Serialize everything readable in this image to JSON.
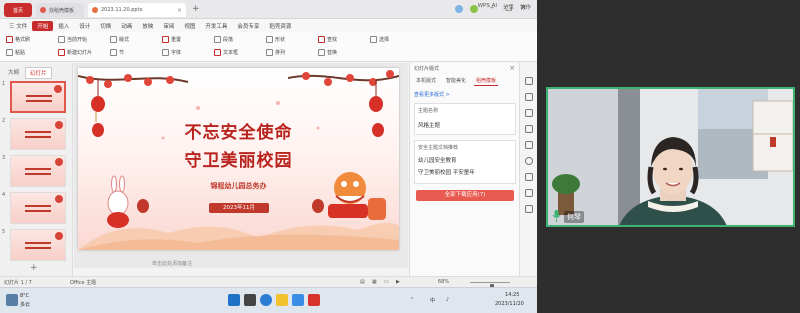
{
  "window": {
    "home_tab": "首页",
    "tabs": [
      {
        "label": "找稻壳模板"
      },
      {
        "label": "2023.11.20.pptx"
      }
    ],
    "new_tab_symbol": "+"
  },
  "menu": {
    "items": [
      "三 文件",
      "开始",
      "插入",
      "设计",
      "切换",
      "动画",
      "放映",
      "审阅",
      "视图",
      "开发工具",
      "会员专享",
      "稻壳资源"
    ],
    "active_index": 1,
    "right_items": [
      "WPS AI",
      "分享",
      "协作"
    ]
  },
  "ribbon": {
    "groups": [
      "格式刷",
      "粘贴",
      "当前开始",
      "新建幻灯片",
      "版式",
      "节",
      "重置",
      "字体",
      "段落",
      "文本框",
      "形状",
      "排列",
      "查找",
      "替换",
      "选择"
    ]
  },
  "left_pane": {
    "tabs": [
      "大纲",
      "幻灯片"
    ],
    "active_tab": 1,
    "slide_numbers": [
      "1",
      "2",
      "3",
      "4",
      "5"
    ],
    "selected": 0,
    "add_symbol": "+"
  },
  "slide": {
    "title_line1": "不忘安全使命",
    "title_line2": "守卫美丽校园",
    "subtitle": "锦程幼儿园总务办",
    "date": "2023年11月",
    "notes_placeholder": "单击此处添加备注"
  },
  "right_panel": {
    "title": "幻灯片版式",
    "tabs": [
      "本机版式",
      "智能美化",
      "稻壳模板"
    ],
    "active_tab": 2,
    "link": "查看更多版式 >",
    "box1_label": "主题名称",
    "box1_value": "风格主题",
    "box2_label": "安全主题文档推荐",
    "box2_line1": "幼儿园安全教育",
    "box2_line2": "守卫美丽校园 平安童年",
    "action_button": "全部下载应用(7)"
  },
  "status": {
    "slide_count": "幻灯片 1 / 7",
    "theme": "Office 主题",
    "zoom": "68%",
    "zoom_level": 0.55
  },
  "taskbar": {
    "weather_temp": "8°C",
    "weather_text": "多云",
    "time": "14:25",
    "date": "2023/11/20",
    "lang": "中"
  },
  "video": {
    "name": "何琴",
    "border_color": "#3cb371"
  },
  "colors": {
    "accent": "#c92c2c",
    "slide_title": "#b8231e"
  }
}
